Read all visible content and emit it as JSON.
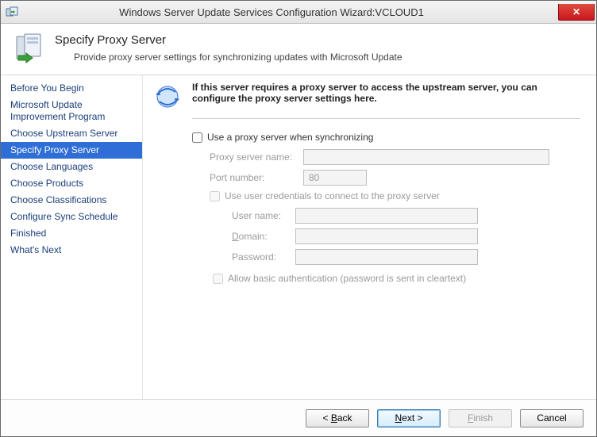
{
  "window": {
    "title": "Windows Server Update Services Configuration Wizard:VCLOUD1",
    "close_glyph": "✕"
  },
  "header": {
    "title": "Specify Proxy Server",
    "subtitle": "Provide proxy server settings for synchronizing updates with Microsoft Update"
  },
  "sidebar": {
    "steps": [
      "Before You Begin",
      "Microsoft Update Improvement Program",
      "Choose Upstream Server",
      "Specify Proxy Server",
      "Choose Languages",
      "Choose Products",
      "Choose Classifications",
      "Configure Sync Schedule",
      "Finished",
      "What's Next"
    ],
    "selected_index": 3
  },
  "intro": "If this server requires a proxy server to access the upstream server, you can configure the proxy server settings here.",
  "form": {
    "use_proxy_label": "Use a proxy server when synchronizing",
    "use_proxy_checked": false,
    "proxy_name_label": "Proxy server name:",
    "proxy_name_value": "",
    "port_label": "Port number:",
    "port_value": "80",
    "use_creds_label": "Use user credentials to connect to the proxy server",
    "use_creds_checked": false,
    "user_label": "User name:",
    "user_value": "",
    "domain_label_prefix": "D",
    "domain_label_rest": "omain:",
    "domain_value": "",
    "password_label": "Password:",
    "password_value": "",
    "allow_basic_label": "Allow basic authentication (password is sent in cleartext)",
    "allow_basic_checked": false
  },
  "buttons": {
    "back_prefix": "< ",
    "back_u": "B",
    "back_rest": "ack",
    "next_u": "N",
    "next_rest": "ext >",
    "finish_u": "F",
    "finish_rest": "inish",
    "cancel": "Cancel"
  }
}
